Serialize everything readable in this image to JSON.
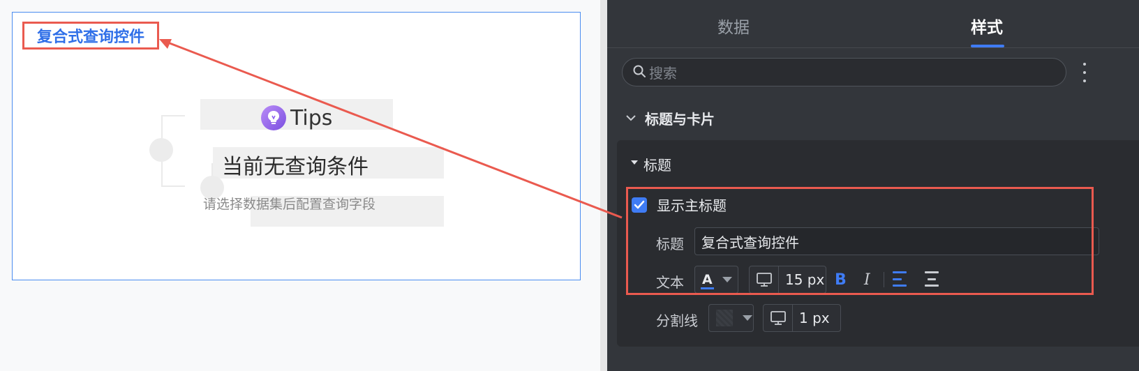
{
  "canvas": {
    "card_title": "复合式查询控件",
    "tips": "Tips",
    "empty_title": "当前无查询条件",
    "empty_subtitle": "请选择数据集后配置查询字段"
  },
  "panel": {
    "tabs": [
      {
        "label": "数据",
        "active": false
      },
      {
        "label": "样式",
        "active": true
      }
    ],
    "search_placeholder": "搜索",
    "section": {
      "label": "标题与卡片",
      "expanded": true
    },
    "subsection": {
      "label": "标题",
      "expanded": true
    },
    "show_title": {
      "label": "显示主标题",
      "checked": true
    },
    "title_field": {
      "label": "标题",
      "value": "复合式查询控件"
    },
    "text_row": {
      "label": "文本",
      "color_letter": "A",
      "font_size": "15 px",
      "bold": "B",
      "italic": "I"
    },
    "split_row": {
      "label": "分割线",
      "width": "1 px"
    }
  },
  "colors": {
    "accent": "#3f7cf5",
    "annotation": "#ea5a4f",
    "panel_bg": "#33363b"
  }
}
